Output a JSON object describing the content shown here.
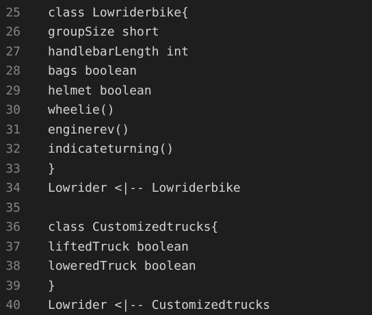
{
  "editor": {
    "lines": [
      {
        "number": "25",
        "text": "class Lowriderbike{"
      },
      {
        "number": "26",
        "text": "groupSize short"
      },
      {
        "number": "27",
        "text": "handlebarLength int"
      },
      {
        "number": "28",
        "text": "bags boolean"
      },
      {
        "number": "29",
        "text": "helmet boolean"
      },
      {
        "number": "30",
        "text": "wheelie()"
      },
      {
        "number": "31",
        "text": "enginerev()"
      },
      {
        "number": "32",
        "text": "indicateturning()"
      },
      {
        "number": "33",
        "text": "}"
      },
      {
        "number": "34",
        "text": "Lowrider <|-- Lowriderbike"
      },
      {
        "number": "35",
        "text": ""
      },
      {
        "number": "36",
        "text": "class Customizedtrucks{"
      },
      {
        "number": "37",
        "text": "liftedTruck boolean"
      },
      {
        "number": "38",
        "text": "loweredTruck boolean"
      },
      {
        "number": "39",
        "text": "}"
      },
      {
        "number": "40",
        "text": "Lowrider <|-- Customizedtrucks"
      }
    ]
  },
  "colors": {
    "background": "#1e1e1e",
    "line_number": "#858585",
    "text": "#d4d4d4"
  }
}
